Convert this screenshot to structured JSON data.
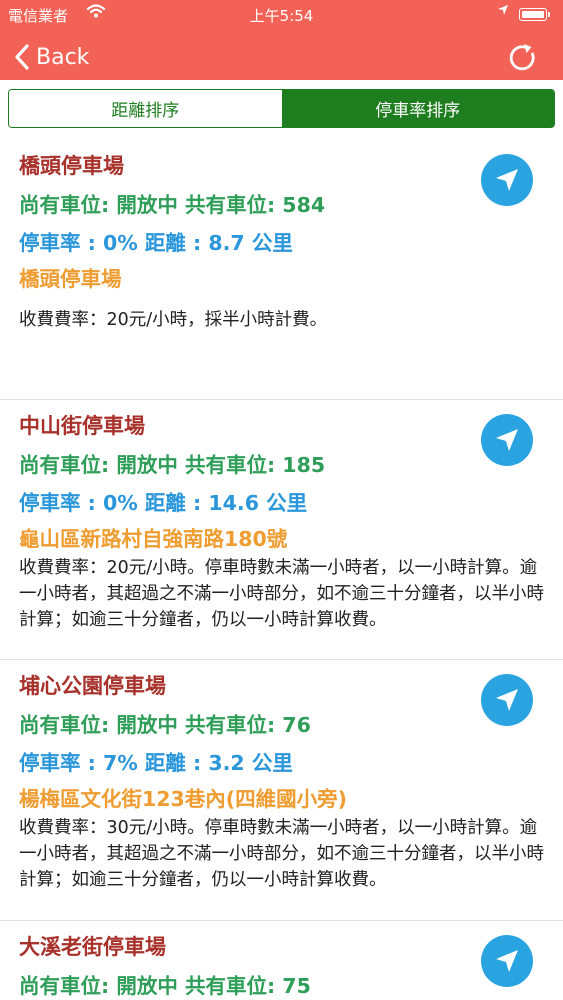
{
  "status_bar": {
    "carrier": "電信業者",
    "time": "上午5:54"
  },
  "nav": {
    "back_label": "Back"
  },
  "sort": {
    "distance_label": "距離排序",
    "occupancy_label": "停車率排序"
  },
  "colors": {
    "header": "#f26256",
    "green_tab": "#1e7d1e",
    "name": "#a8312b",
    "status": "#2e9e58",
    "rate": "#2b97db",
    "address": "#ef9c30",
    "nav_button": "#2aa4e0"
  },
  "lots": [
    {
      "name": "橋頭停車場",
      "status_line": "尚有車位: 開放中  共有車位: 584",
      "rate_line": "停車率 : 0%  距離 : 8.7 公里",
      "address": "橋頭停車場",
      "fee": "收費費率：20元/小時，採半小時計費。"
    },
    {
      "name": "中山街停車場",
      "status_line": "尚有車位: 開放中  共有車位: 185",
      "rate_line": "停車率 : 0%  距離 : 14.6 公里",
      "address": "龜山區新路村自強南路180號",
      "fee": "收費費率：20元/小時。停車時數未滿一小時者，以一小時計算。逾一小時者，其超過之不滿一小時部分，如不逾三十分鐘者，以半小時計算；如逾三十分鐘者，仍以一小時計算收費。"
    },
    {
      "name": "埔心公園停車場",
      "status_line": "尚有車位: 開放中  共有車位: 76",
      "rate_line": "停車率 : 7%  距離 : 3.2 公里",
      "address": "楊梅區文化街123巷內(四維國小旁)",
      "fee": "收費費率：30元/小時。停車時數未滿一小時者，以一小時計算。逾一小時者，其超過之不滿一小時部分，如不逾三十分鐘者，以半小時計算；如逾三十分鐘者，仍以一小時計算收費。"
    },
    {
      "name": "大溪老街停車場",
      "status_line": "尚有車位: 開放中  共有車位: 75"
    }
  ]
}
